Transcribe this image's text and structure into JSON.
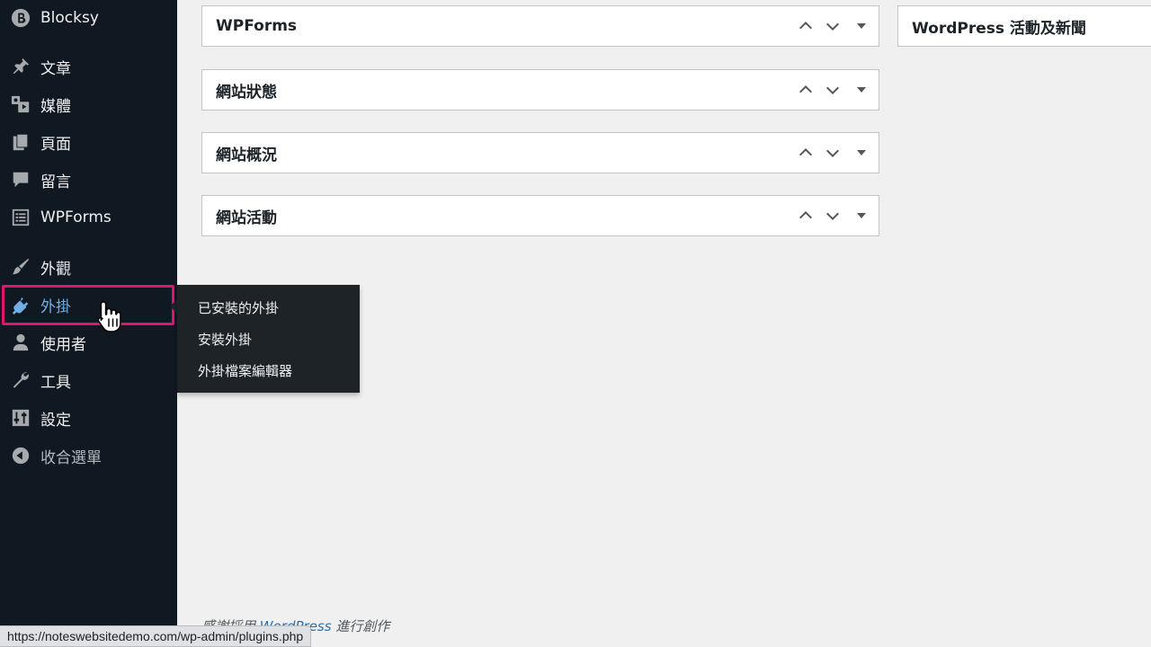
{
  "sidebar": {
    "items": [
      {
        "label": "Blocksy",
        "icon": "blocksy-logo-icon"
      },
      {
        "label": "文章",
        "icon": "pushpin-icon"
      },
      {
        "label": "媒體",
        "icon": "media-icon"
      },
      {
        "label": "頁面",
        "icon": "page-icon"
      },
      {
        "label": "留言",
        "icon": "comment-icon"
      },
      {
        "label": "WPForms",
        "icon": "wpforms-icon"
      },
      {
        "label": "外觀",
        "icon": "paintbrush-icon"
      },
      {
        "label": "外掛",
        "icon": "plugin-icon"
      },
      {
        "label": "使用者",
        "icon": "user-icon"
      },
      {
        "label": "工具",
        "icon": "wrench-icon"
      },
      {
        "label": "設定",
        "icon": "settings-icon"
      },
      {
        "label": "收合選單",
        "icon": "collapse-icon"
      }
    ],
    "active_item": "外掛"
  },
  "submenu": {
    "items": [
      {
        "label": "已安裝的外掛"
      },
      {
        "label": "安裝外掛"
      },
      {
        "label": "外掛檔案編輯器"
      }
    ]
  },
  "postboxes": [
    {
      "title": "WPForms"
    },
    {
      "title": "網站狀態"
    },
    {
      "title": "網站概況"
    },
    {
      "title": "網站活動"
    }
  ],
  "right_postbox": {
    "title": "WordPress 活動及新聞"
  },
  "footer": {
    "prefix": "感謝採用",
    "link": "WordPress",
    "suffix": "進行創作"
  },
  "status_bar": {
    "url": "https://noteswebsitedemo.com/wp-admin/plugins.php"
  },
  "colors": {
    "sidebar_bg": "#101821",
    "submenu_bg": "#1d2327",
    "active_text": "#72aee6",
    "highlight": "#e0156e",
    "content_bg": "#f0f0f1"
  }
}
